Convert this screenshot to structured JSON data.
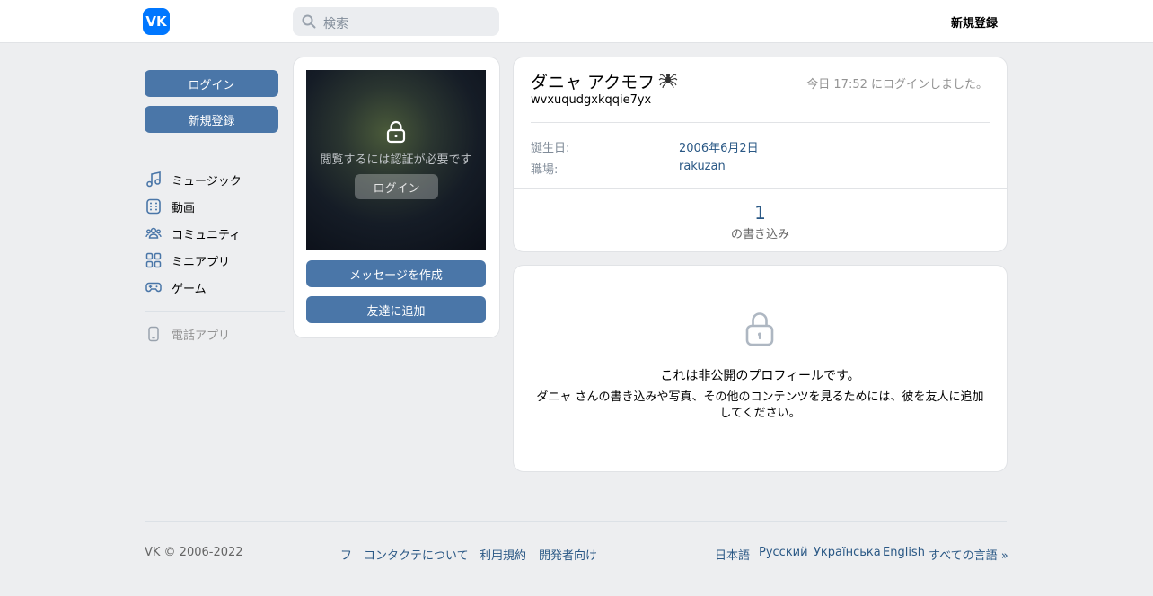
{
  "header": {
    "logo_text": "VK",
    "search_placeholder": "検索",
    "signup_label": "新規登録"
  },
  "sidebar": {
    "login_label": "ログイン",
    "signup_label": "新規登録",
    "items": [
      {
        "label": "ミュージック",
        "icon": "music-icon"
      },
      {
        "label": "動画",
        "icon": "video-icon"
      },
      {
        "label": "コミュニティ",
        "icon": "community-icon"
      },
      {
        "label": "ミニアプリ",
        "icon": "mini-apps-icon"
      },
      {
        "label": "ゲーム",
        "icon": "gamepad-icon"
      }
    ],
    "phone_app_label": "電話アプリ"
  },
  "photo_card": {
    "auth_text": "閲覧するには認証が必要です",
    "login_label": "ログイン",
    "message_label": "メッセージを作成",
    "add_friend_label": "友達に追加"
  },
  "profile": {
    "name": "ダニャ アクモフ",
    "status": "wvxuqudgxkqqie7yx",
    "last_seen": "今日 17:52 にログインしました。",
    "info": [
      {
        "label": "誕生日:",
        "value": "2006年6月2日"
      },
      {
        "label": "職場:",
        "value": "rakuzan"
      }
    ],
    "posts_count": "1",
    "posts_label": "の書き込み"
  },
  "private": {
    "title": "これは非公開のプロフィールです。",
    "description": "ダニャ さんの書き込みや写真、その他のコンテンツを見るためには、彼を友人に追加してください。"
  },
  "footer": {
    "copyright": "VK © 2006-2022",
    "links": [
      "フ",
      "コンタクテについて",
      "利用規約",
      "開発者向け"
    ],
    "languages": [
      "日本語",
      "Русский",
      "Українська",
      "English",
      "すべての言語 »"
    ]
  },
  "colors": {
    "accent": "#4a76a8",
    "link": "#2a5885",
    "brand": "#0077ff",
    "background": "#edeef0"
  }
}
